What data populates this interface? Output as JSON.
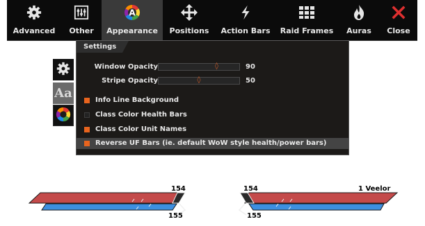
{
  "toolbar": {
    "items": [
      {
        "label": "Advanced",
        "icon": "gear-icon"
      },
      {
        "label": "Other",
        "icon": "sliders-icon"
      },
      {
        "label": "Appearance",
        "icon": "color-wheel-icon",
        "active": true
      },
      {
        "label": "Positions",
        "icon": "move-arrows-icon"
      },
      {
        "label": "Action Bars",
        "icon": "lightning-icon"
      },
      {
        "label": "Raid Frames",
        "icon": "grid-icon"
      },
      {
        "label": "Auras",
        "icon": "flame-icon"
      },
      {
        "label": "Close",
        "icon": "close-icon"
      }
    ]
  },
  "side_tabs": {
    "general_icon": "gear-icon",
    "fonts_icon": "font-aa-icon",
    "fonts_glyph": "Aa",
    "colors_icon": "color-wheel-icon"
  },
  "settings": {
    "header": "Settings",
    "sliders": [
      {
        "label": "Window Opacity",
        "value": "90",
        "fraction": 0.72
      },
      {
        "label": "Stripe Opacity",
        "value": "50",
        "fraction": 0.5
      }
    ],
    "checkboxes": [
      {
        "label": "Info Line Background",
        "checked": true
      },
      {
        "label": "Class Color Health Bars",
        "checked": false
      },
      {
        "label": "Class Color Unit Names",
        "checked": true
      },
      {
        "label": "Reverse UF Bars (ie. default WoW style health/power bars)",
        "checked": true,
        "highlighted": true
      }
    ]
  },
  "preview": {
    "player": {
      "health_text": "154",
      "power_text": "155"
    },
    "target": {
      "health_text": "154",
      "power_text": "155",
      "name": "1 Veelor"
    }
  },
  "colors": {
    "accent": "#e8641e",
    "health": "#c44a4a",
    "power": "#3d8fe0",
    "close": "#e03030"
  }
}
